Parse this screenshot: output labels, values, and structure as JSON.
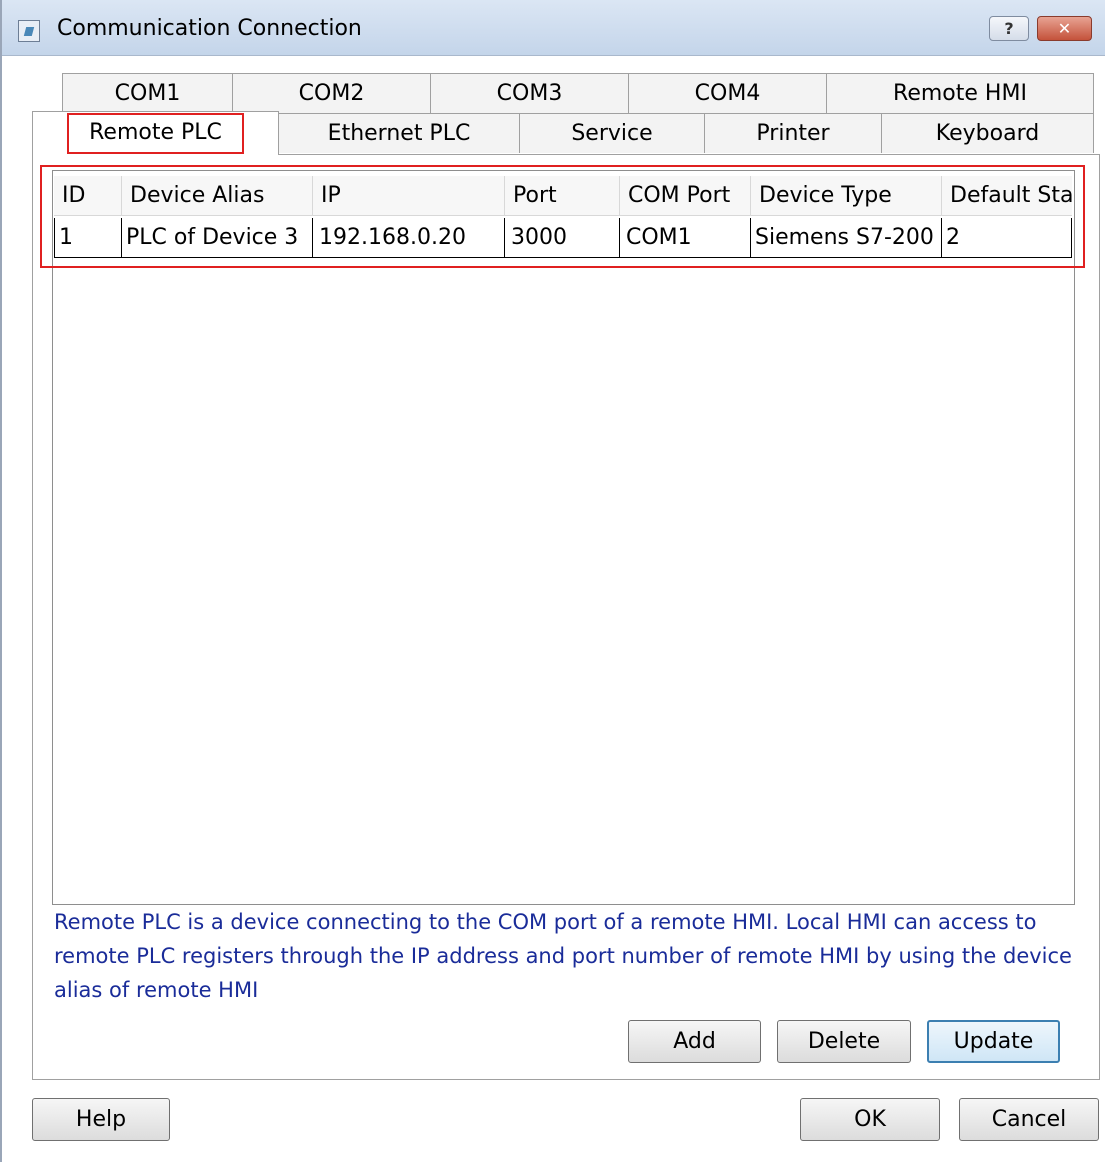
{
  "window": {
    "title": "Communication Connection",
    "help_button": "?",
    "close_button": "✕"
  },
  "tabs_row1": [
    {
      "label": "COM1"
    },
    {
      "label": "COM2"
    },
    {
      "label": "COM3"
    },
    {
      "label": "COM4"
    },
    {
      "label": "Remote HMI"
    }
  ],
  "tabs_row2": [
    {
      "label": "Remote PLC",
      "active": true
    },
    {
      "label": "Ethernet PLC"
    },
    {
      "label": "Service"
    },
    {
      "label": "Printer"
    },
    {
      "label": "Keyboard"
    }
  ],
  "table": {
    "columns": [
      "ID",
      "Device Alias",
      "IP",
      "Port",
      "COM Port",
      "Device Type",
      "Default Sta"
    ],
    "rows": [
      [
        "1",
        "PLC of Device 3",
        "192.168.0.20",
        "3000",
        "COM1",
        "Siemens S7-200",
        "2"
      ]
    ]
  },
  "info": "Remote PLC is a device connecting to the COM port of a remote HMI. Local HMI can access to remote PLC registers through the IP address and port number of remote HMI by using the device alias of remote HMI",
  "actions": {
    "add": "Add",
    "delete": "Delete",
    "update": "Update"
  },
  "footer": {
    "help": "Help",
    "ok": "OK",
    "cancel": "Cancel"
  },
  "colors": {
    "highlight": "#e02020",
    "info_text": "#1a2c99",
    "default_button": "#3c7fb1"
  }
}
